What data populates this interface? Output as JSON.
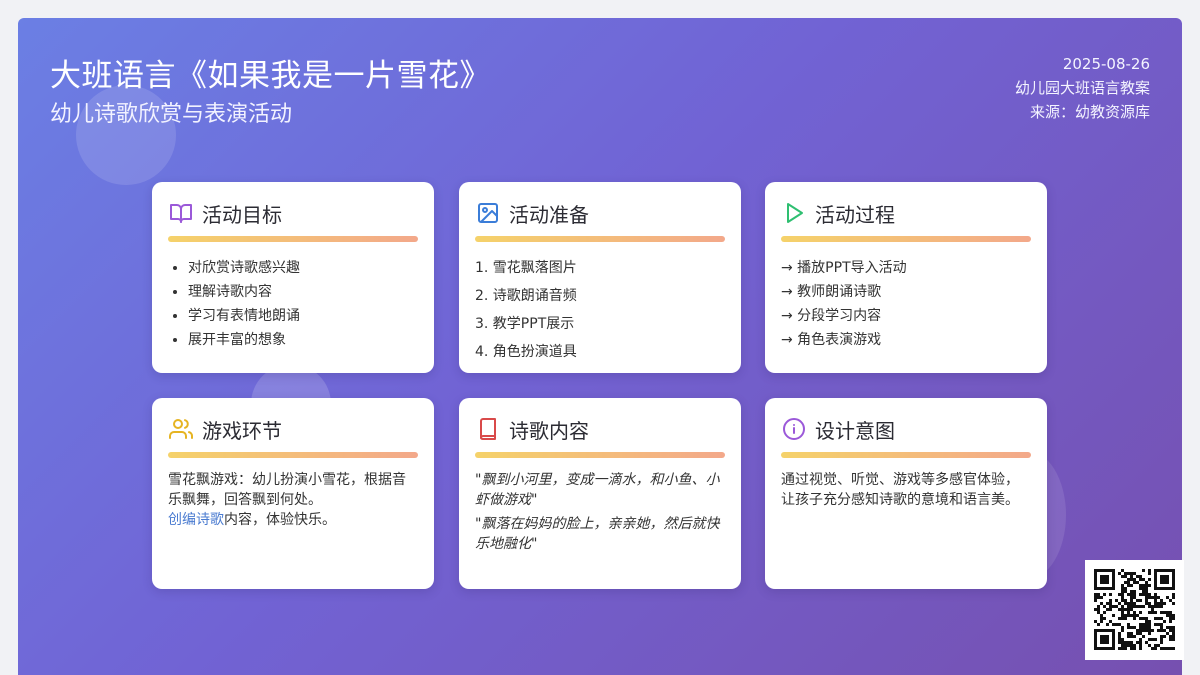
{
  "header": {
    "title": "大班语言《如果我是一片雪花》",
    "subtitle": "幼儿诗歌欣赏与表演活动",
    "date": "2025-08-26",
    "category": "幼儿园大班语言教案",
    "source": "来源：幼教资源库"
  },
  "cards": {
    "goals": {
      "title": "活动目标",
      "icon": "book-open-icon",
      "items": [
        "对欣赏诗歌感兴趣",
        "理解诗歌内容",
        "学习有表情地朗诵",
        "展开丰富的想象"
      ]
    },
    "prep": {
      "title": "活动准备",
      "icon": "image-icon",
      "items": [
        "1. 雪花飘落图片",
        "2. 诗歌朗诵音频",
        "3. 教学PPT展示",
        "4. 角色扮演道具"
      ]
    },
    "process": {
      "title": "活动过程",
      "icon": "play-icon",
      "items": [
        "→ 播放PPT导入活动",
        "→ 教师朗诵诗歌",
        "→ 分段学习内容",
        "→ 角色表演游戏"
      ]
    },
    "game": {
      "title": "游戏环节",
      "icon": "users-icon",
      "text": "雪花飘游戏：幼儿扮演小雪花，根据音乐飘舞，回答飘到何处。",
      "link": "创编诗歌",
      "text_after_link": "内容，体验快乐。"
    },
    "poem": {
      "title": "诗歌内容",
      "icon": "book-icon",
      "quote1": "\"飘到小河里，变成一滴水，和小鱼、小虾做游戏\"",
      "quote2": "\"飘落在妈妈的脸上，亲亲她，然后就快乐地融化\""
    },
    "design": {
      "title": "设计意图",
      "icon": "info-icon",
      "text": "通过视觉、听觉、游戏等多感官体验，让孩子充分感知诗歌的意境和语言美。"
    }
  },
  "colors": {
    "accent_purple": "#9b59d9",
    "accent_blue": "#3b7dd8",
    "accent_green": "#2fbf71",
    "accent_yellow": "#e6b422",
    "accent_red": "#d94a4a",
    "link": "#4a7bd0"
  }
}
